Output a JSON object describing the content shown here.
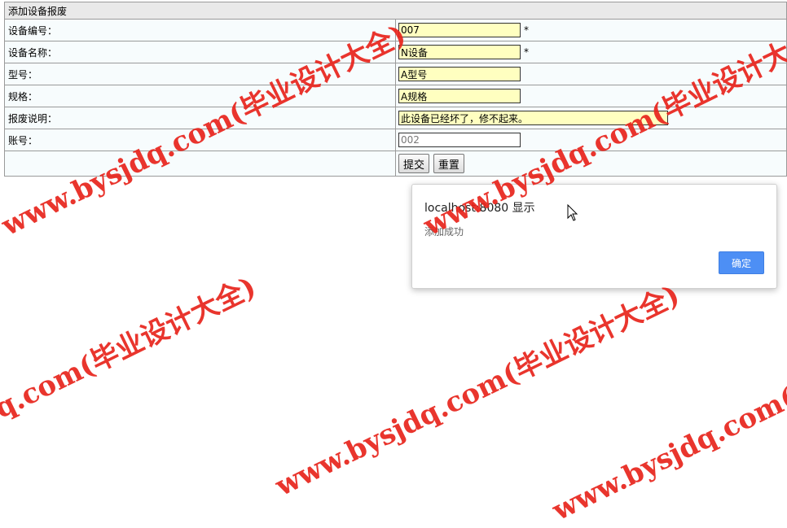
{
  "form": {
    "title": "添加设备报废",
    "rows": [
      {
        "label": "设备编号：",
        "value": "007",
        "required": "*"
      },
      {
        "label": "设备名称：",
        "value": "N设备",
        "required": "*"
      },
      {
        "label": "型号：",
        "value": "A型号"
      },
      {
        "label": "规格：",
        "value": "A规格"
      },
      {
        "label": "报废说明：",
        "value": "此设备已经坏了，修不起来。"
      },
      {
        "label": "账号：",
        "placeholder": "002"
      }
    ],
    "submit_label": "提交",
    "reset_label": "重置"
  },
  "dialog": {
    "title": "localhost:8080 显示",
    "message": "添加成功",
    "ok_label": "确定",
    "accent_color": "#4d8ff5"
  },
  "watermark": {
    "text": "www.bysjdq.com(毕业设计大全)",
    "color": "#e8241c"
  },
  "icons": [
    "mouse-cursor-icon"
  ]
}
